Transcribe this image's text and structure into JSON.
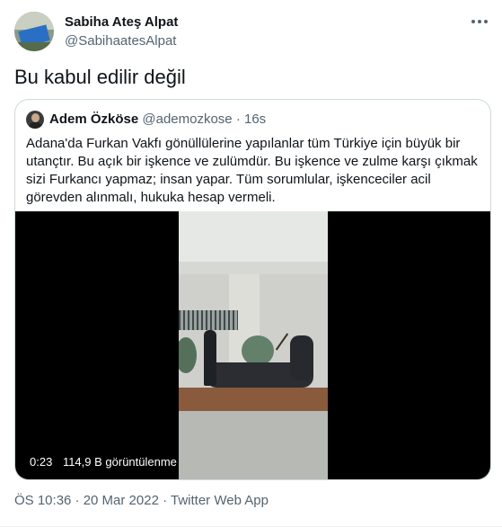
{
  "author": {
    "display_name": "Sabiha Ateş Alpat",
    "handle": "@SabihaatesAlpat"
  },
  "tweet_text": "Bu kabul edilir değil",
  "quoted": {
    "display_name": "Adem Özköse",
    "handle": "@ademozkose",
    "dot": "·",
    "time": "16s",
    "text": "Adana'da Furkan Vakfı gönüllülerine yapılanlar tüm Türkiye için büyük bir utançtır. Bu açık bir işkence ve zulümdür. Bu işkence ve zulme karşı çıkmak sizi Furkancı yapmaz; insan yapar. Tüm sorumlular, işkenceciler acil görevden alınmalı, hukuka hesap vermeli.",
    "video": {
      "duration": "0:23",
      "views": "114,9 B görüntülenme"
    }
  },
  "meta": {
    "timestamp": "ÖS 10:36 · 20 Mar 2022",
    "separator": " · ",
    "source": "Twitter Web App"
  },
  "icons": {
    "more": "more-horizontal-icon"
  },
  "colors": {
    "text_primary": "#0f1419",
    "text_secondary": "#536471",
    "border": "#cfd9de"
  }
}
